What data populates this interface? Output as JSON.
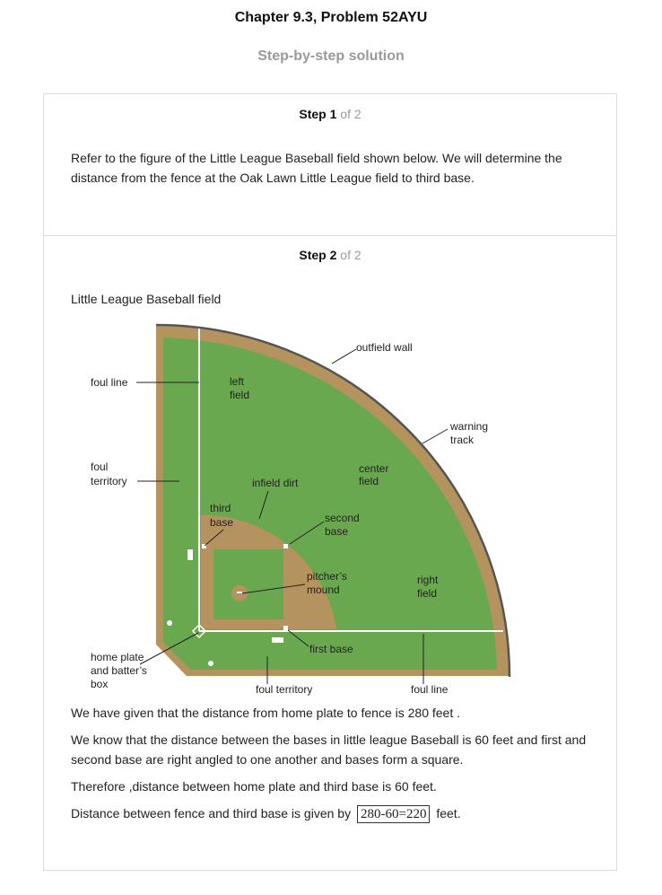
{
  "header": {
    "title": "Chapter 9.3, Problem 52AYU",
    "subtitle": "Step-by-step solution"
  },
  "steps": [
    {
      "label": "Step",
      "number": "1",
      "of": "of 2",
      "text": "Refer to the figure of the Little League Baseball field shown below. We will determine the distance from the fence at the Oak Lawn Little League field to third base."
    },
    {
      "label": "Step",
      "number": "2",
      "of": "of 2",
      "figure_title": "Little League Baseball field",
      "figure_labels": {
        "outfield_wall": "outfield wall",
        "foul_line_left": "foul line",
        "left_field_1": "left",
        "left_field_2": "field",
        "warning_track_1": "warning",
        "warning_track_2": "track",
        "foul_territory_left_1": "foul",
        "foul_territory_left_2": "territory",
        "center_field_1": "center",
        "center_field_2": "field",
        "infield_dirt": "infield dirt",
        "third_base_1": "third",
        "third_base_2": "base",
        "second_base_1": "second",
        "second_base_2": "base",
        "pitchers_mound_1": "pitcher’s",
        "pitchers_mound_2": "mound",
        "right_field_1": "right",
        "right_field_2": "field",
        "first_base": "first base",
        "home_plate_1": "home plate",
        "home_plate_2": "and batter’s",
        "home_plate_3": "box",
        "foul_territory_bottom": "foul territory",
        "foul_line_bottom": "foul line"
      },
      "para1": "We have given that the distance from home plate to fence is 280 feet .",
      "para2": "We know that the distance between the bases in little league Baseball is 60 feet and first and second base are right angled to one another and bases form a square.",
      "para3": "Therefore ,distance between home plate and third base is 60 feet.",
      "para4_before": "Distance between fence and third base is given by",
      "answer": "280-60=220",
      "para4_after": "feet."
    }
  ],
  "colors": {
    "grass": "#6aa84f",
    "dirt": "#b5935f",
    "wall": "#555555"
  }
}
